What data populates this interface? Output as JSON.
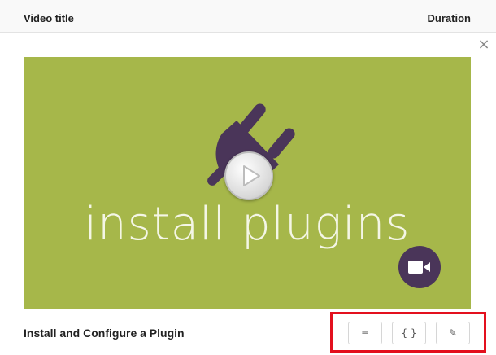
{
  "table_header": {
    "title_col": "Video title",
    "duration_col": "Duration"
  },
  "close_label": "×",
  "video": {
    "thumbnail_text": "install plugins",
    "name": "Install and Configure a Plugin",
    "thumbnail_bg": "#a6b74a",
    "accent_color": "#4a3559"
  },
  "actions": {
    "list_glyph": "≡",
    "code_glyph": "{ }",
    "edit_glyph": "✎"
  },
  "icons": [
    "plug-icon",
    "play-icon",
    "video-camera-icon",
    "list-icon",
    "code-icon",
    "pencil-icon",
    "close-icon"
  ]
}
